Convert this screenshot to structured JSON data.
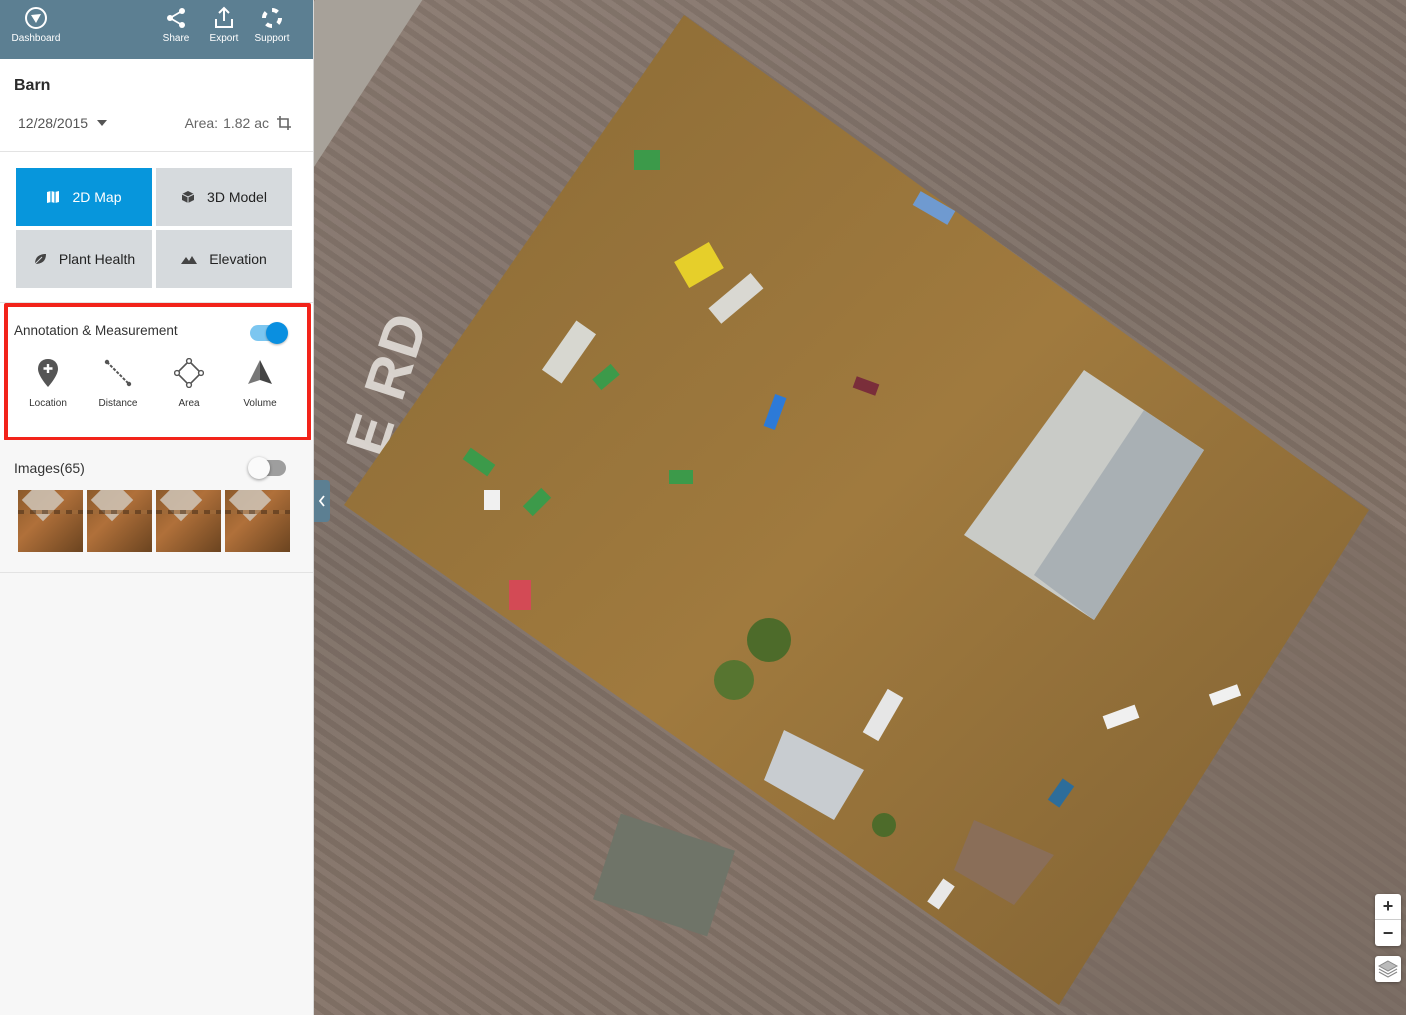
{
  "topbar": {
    "dashboard_label": "Dashboard",
    "share_label": "Share",
    "export_label": "Export",
    "support_label": "Support"
  },
  "project": {
    "title": "Barn",
    "date": "12/28/2015",
    "area_label": "Area:",
    "area_value": "1.82 ac"
  },
  "views": {
    "map2d": "2D Map",
    "model3d": "3D Model",
    "plant_health": "Plant Health",
    "elevation": "Elevation",
    "active": "2D Map"
  },
  "annotation": {
    "title": "Annotation & Measurement",
    "enabled": true,
    "tools": {
      "location": "Location",
      "distance": "Distance",
      "area": "Area",
      "volume": "Volume"
    }
  },
  "images": {
    "title": "Images(65)",
    "enabled": false,
    "thumbnail_count": 4
  },
  "map": {
    "road_label": "E RD",
    "zoom_in": "+",
    "zoom_out": "−"
  },
  "colors": {
    "topbar": "#5c7f92",
    "accent": "#0796dc",
    "highlight": "#f2231a"
  }
}
